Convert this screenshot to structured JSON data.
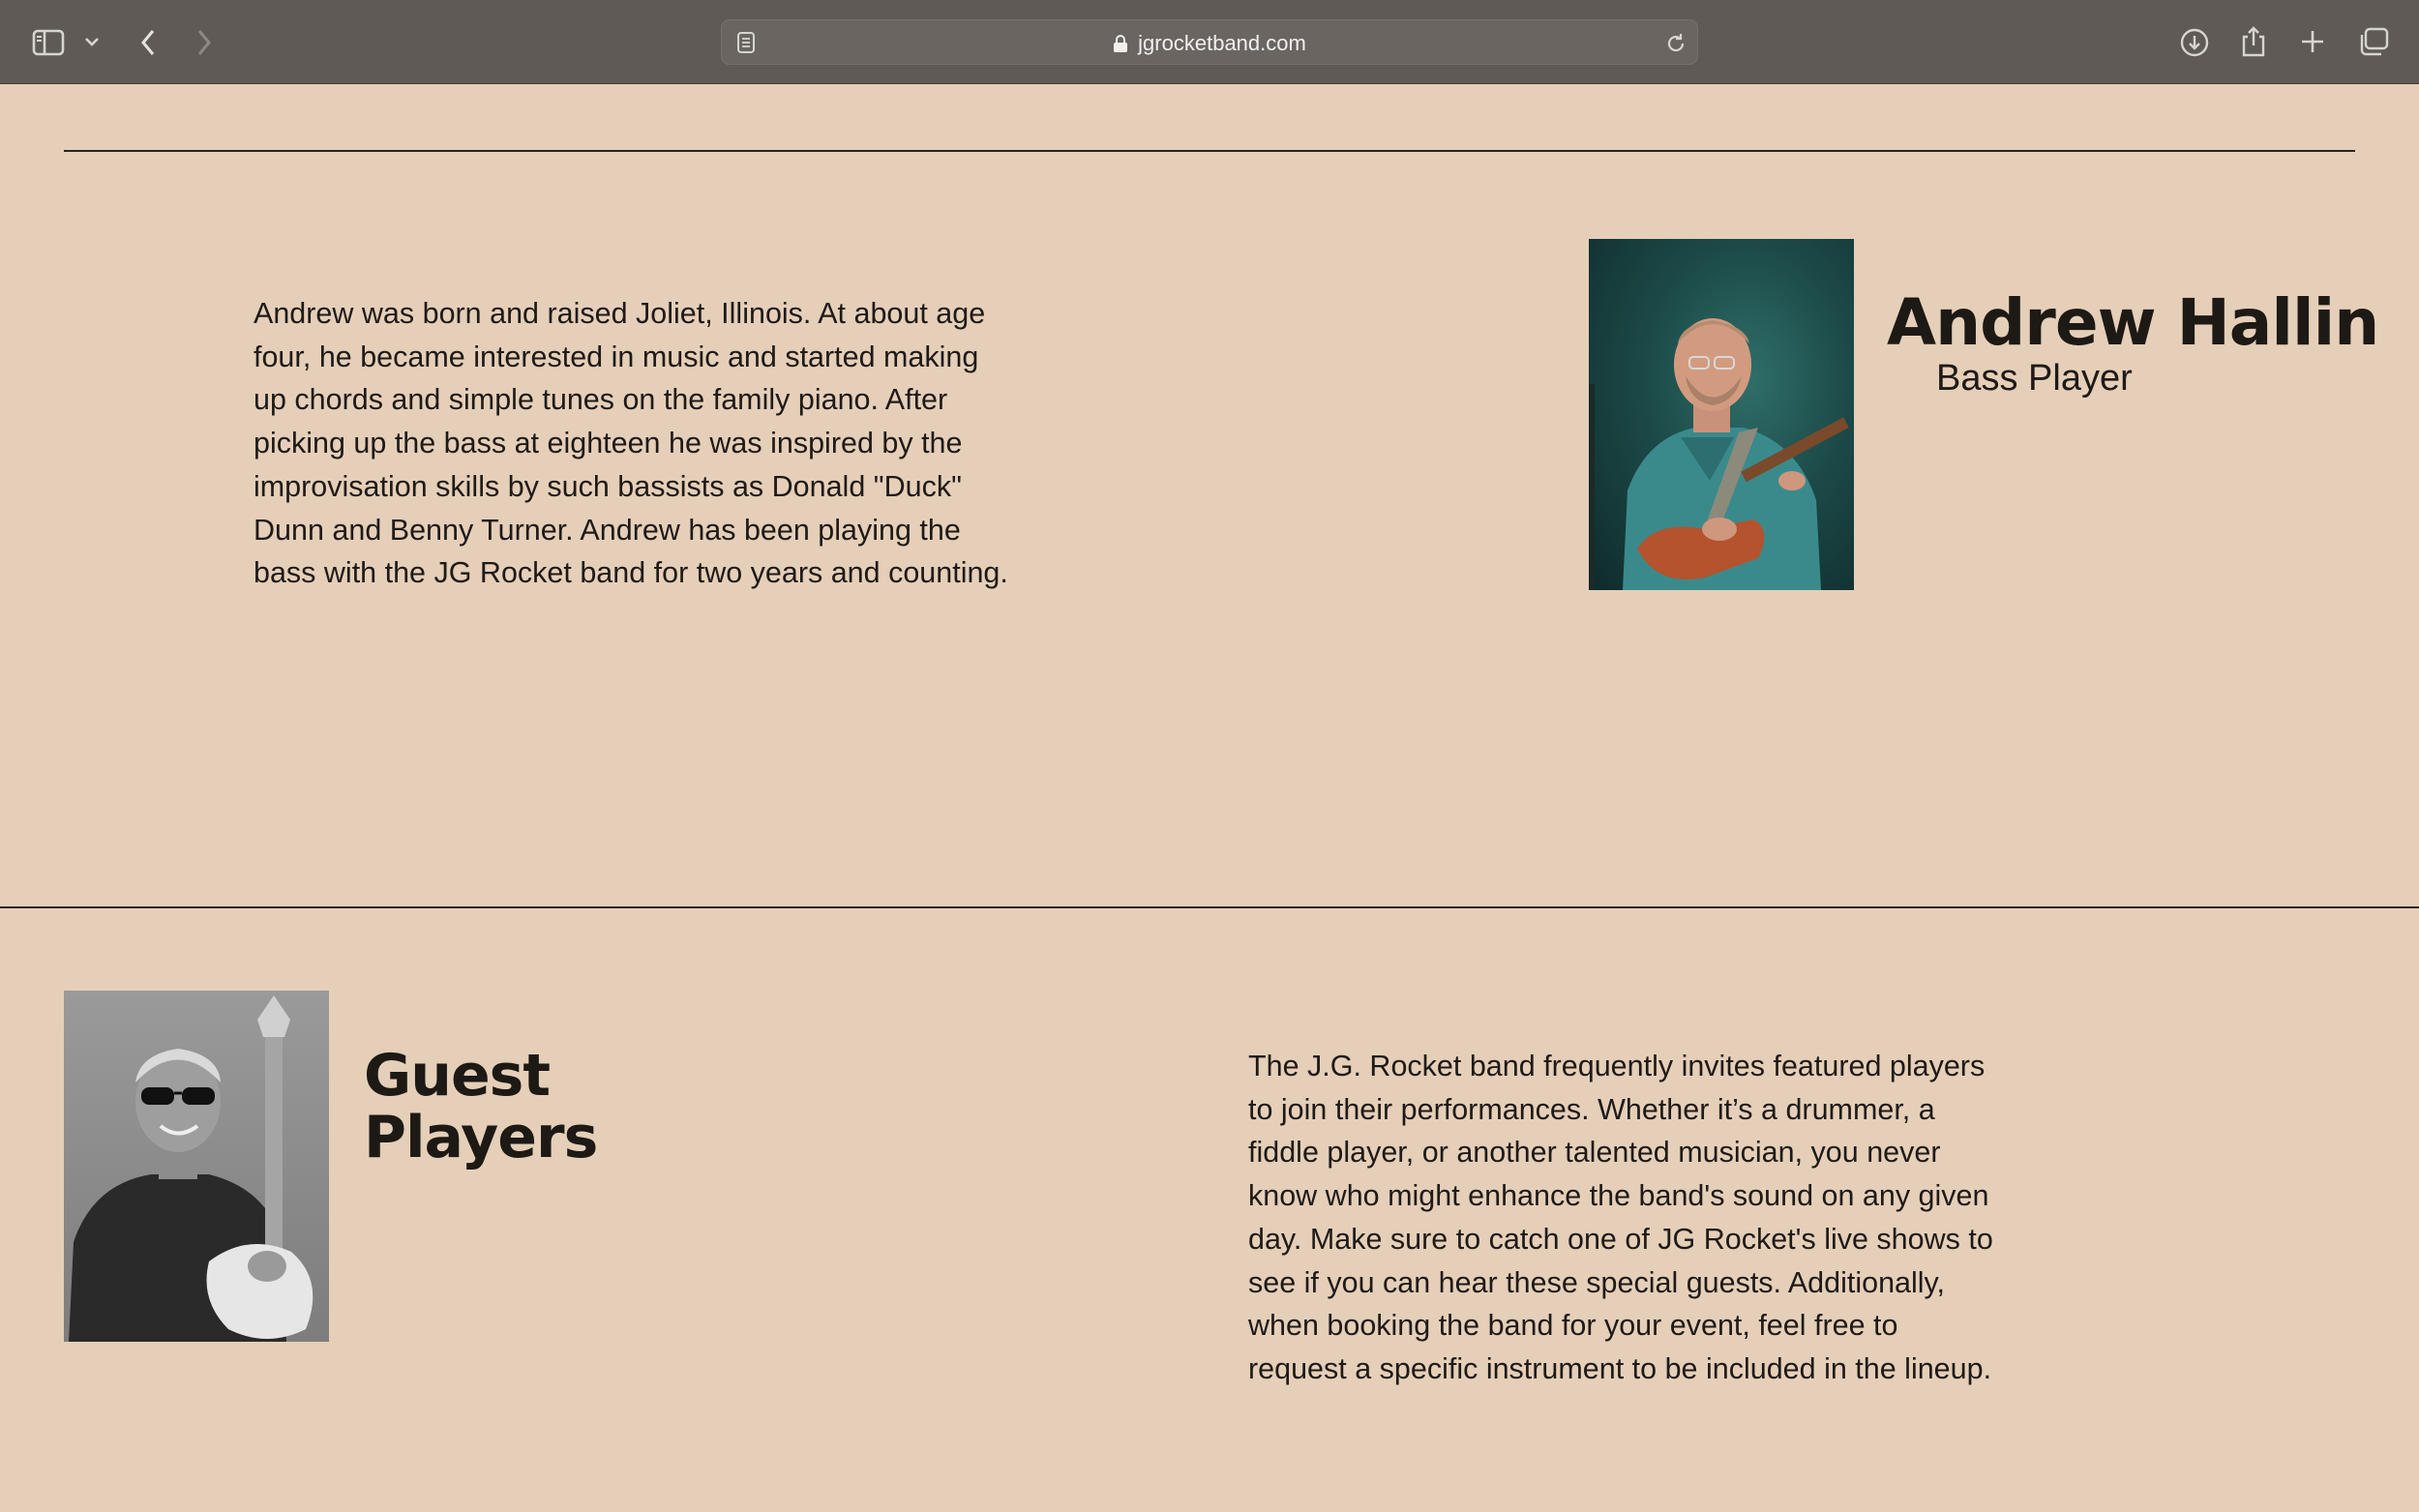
{
  "browser": {
    "url": "jgrocketband.com",
    "icons": {
      "sidebar": "sidebar-icon",
      "chevron": "chevron-down-icon",
      "back": "back-arrow-icon",
      "forward": "forward-arrow-icon",
      "reader": "reader-icon",
      "lock": "lock-icon",
      "reload": "reload-icon",
      "download": "download-icon",
      "share": "share-icon",
      "new_tab": "plus-icon",
      "tabs": "tabs-overview-icon"
    }
  },
  "member": {
    "name": "Andrew Hallin",
    "role": "Bass Player",
    "bio": "Andrew was born and raised Joliet, Illinois. At about age four, he became interested in music and started making up chords and simple tunes on the family piano. After picking up the bass at eighteen he was inspired by the improvisation skills by such bassists as Donald \"Duck\" Dunn and Benny Turner. Andrew has been playing the bass with the JG Rocket band for two years and counting."
  },
  "guests": {
    "title": "Guest Players",
    "description": "The J.G. Rocket band frequently invites featured players to join their performances. Whether it’s a drummer, a fiddle player, or another talented musician, you never know who might enhance the band's sound on any given day. Make sure to catch one of JG Rocket's live shows to see if you can hear these special guests. Additionally, when booking the band for your event, feel free to request a specific instrument to be included in the lineup."
  },
  "colors": {
    "page_background": "#e5cfb8",
    "toolbar_background": "#5f5a56",
    "text": "#1f1a17"
  }
}
